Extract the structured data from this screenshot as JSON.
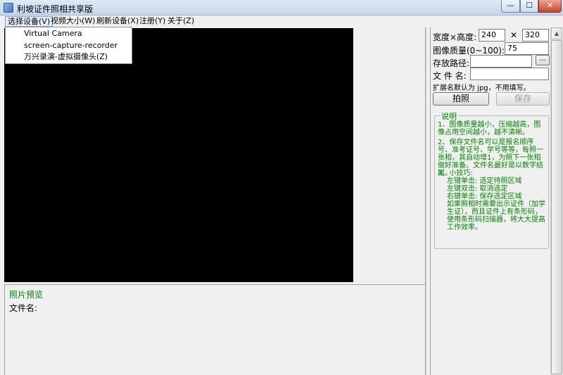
{
  "window": {
    "title": "利坡证件照相共享版",
    "buttons": {
      "minimize": "—",
      "maximize": "☐",
      "close": "✕"
    }
  },
  "menu": [
    {
      "label": "选择设备(V)",
      "active": true
    },
    {
      "label": "视频大小(W)"
    },
    {
      "label": "刷新设备(X)"
    },
    {
      "label": "注册(Y)"
    },
    {
      "label": "关于(Z)"
    }
  ],
  "device_menu": [
    "Virtual Camera",
    "screen-capture-recorder",
    "万兴录演-虚拟摄像头(Z)"
  ],
  "settings": {
    "size_label": "宽度×高度:",
    "width": "240",
    "times": "✕",
    "height": "320",
    "quality_label": "图像质量(0~100):",
    "quality": "75",
    "path_label": "存放路径:",
    "path": "",
    "browse": "...",
    "filename_label": "文 件 名:",
    "filename": "",
    "ext_hint": "扩展名默认为 jpg，不用填写。",
    "shoot_button": "拍照",
    "save_button": "保存"
  },
  "notes": {
    "title": "说明",
    "p1": "1、图像质量越小，压缩越高，图像占用空间越小，越不清晰。",
    "p2": "2、保存文件名可以是报名顺序号、准考证号、学号等等，每照一张相，其自动增1，为照下一张相做好准备。文件名最好是以数字结尾。",
    "p3_title": "3、小技巧:",
    "p3_lines": [
      "左键单击: 选定待照区域",
      "左键双击: 取消选定",
      "右键单击: 保存选定区域"
    ],
    "p3_tail": "如果照相时需要出示证件（加学生证），而且证件上有条形码，使用条形码扫描器，将大大提高工作效率。"
  },
  "preview": {
    "title": "照片预览",
    "filename_label": "文件名:"
  },
  "scrollbar": {
    "up": "▲",
    "down": "▼"
  }
}
